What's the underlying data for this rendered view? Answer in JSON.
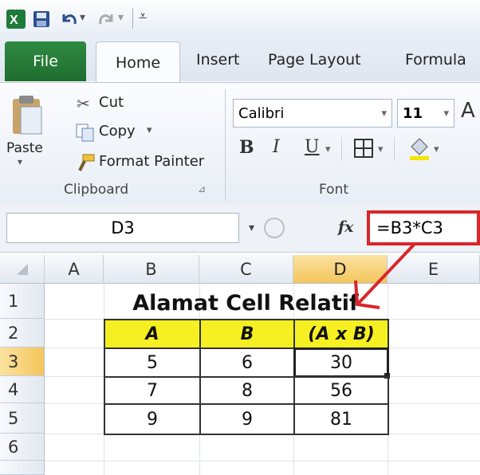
{
  "ribbon_tabs": {
    "file": "File",
    "home": "Home",
    "insert": "Insert",
    "page_layout": "Page Layout",
    "formulas": "Formula"
  },
  "clipboard": {
    "paste": "Paste",
    "cut": "Cut",
    "copy": "Copy",
    "format_painter": "Format Painter",
    "group_label": "Clipboard"
  },
  "font": {
    "name": "Calibri",
    "size": "11",
    "bold": "B",
    "italic": "I",
    "underline": "U",
    "group_label": "Font"
  },
  "formula_bar": {
    "name_box": "D3",
    "fx": "fx",
    "formula": "=B3*C3"
  },
  "columns": [
    "A",
    "B",
    "C",
    "D",
    "E"
  ],
  "rows": [
    "1",
    "2",
    "3",
    "4",
    "5",
    "6"
  ],
  "sheet": {
    "title": "Alamat Cell Relatif",
    "headers": [
      "A",
      "B",
      "(A x B)"
    ],
    "data": [
      [
        "5",
        "6",
        "30"
      ],
      [
        "7",
        "8",
        "56"
      ],
      [
        "9",
        "9",
        "81"
      ]
    ]
  },
  "colors": {
    "accent_red": "#d9262b",
    "header_yellow": "#f6f022",
    "file_green": "#1f6d2f",
    "selected_header": "#f4c55b"
  }
}
